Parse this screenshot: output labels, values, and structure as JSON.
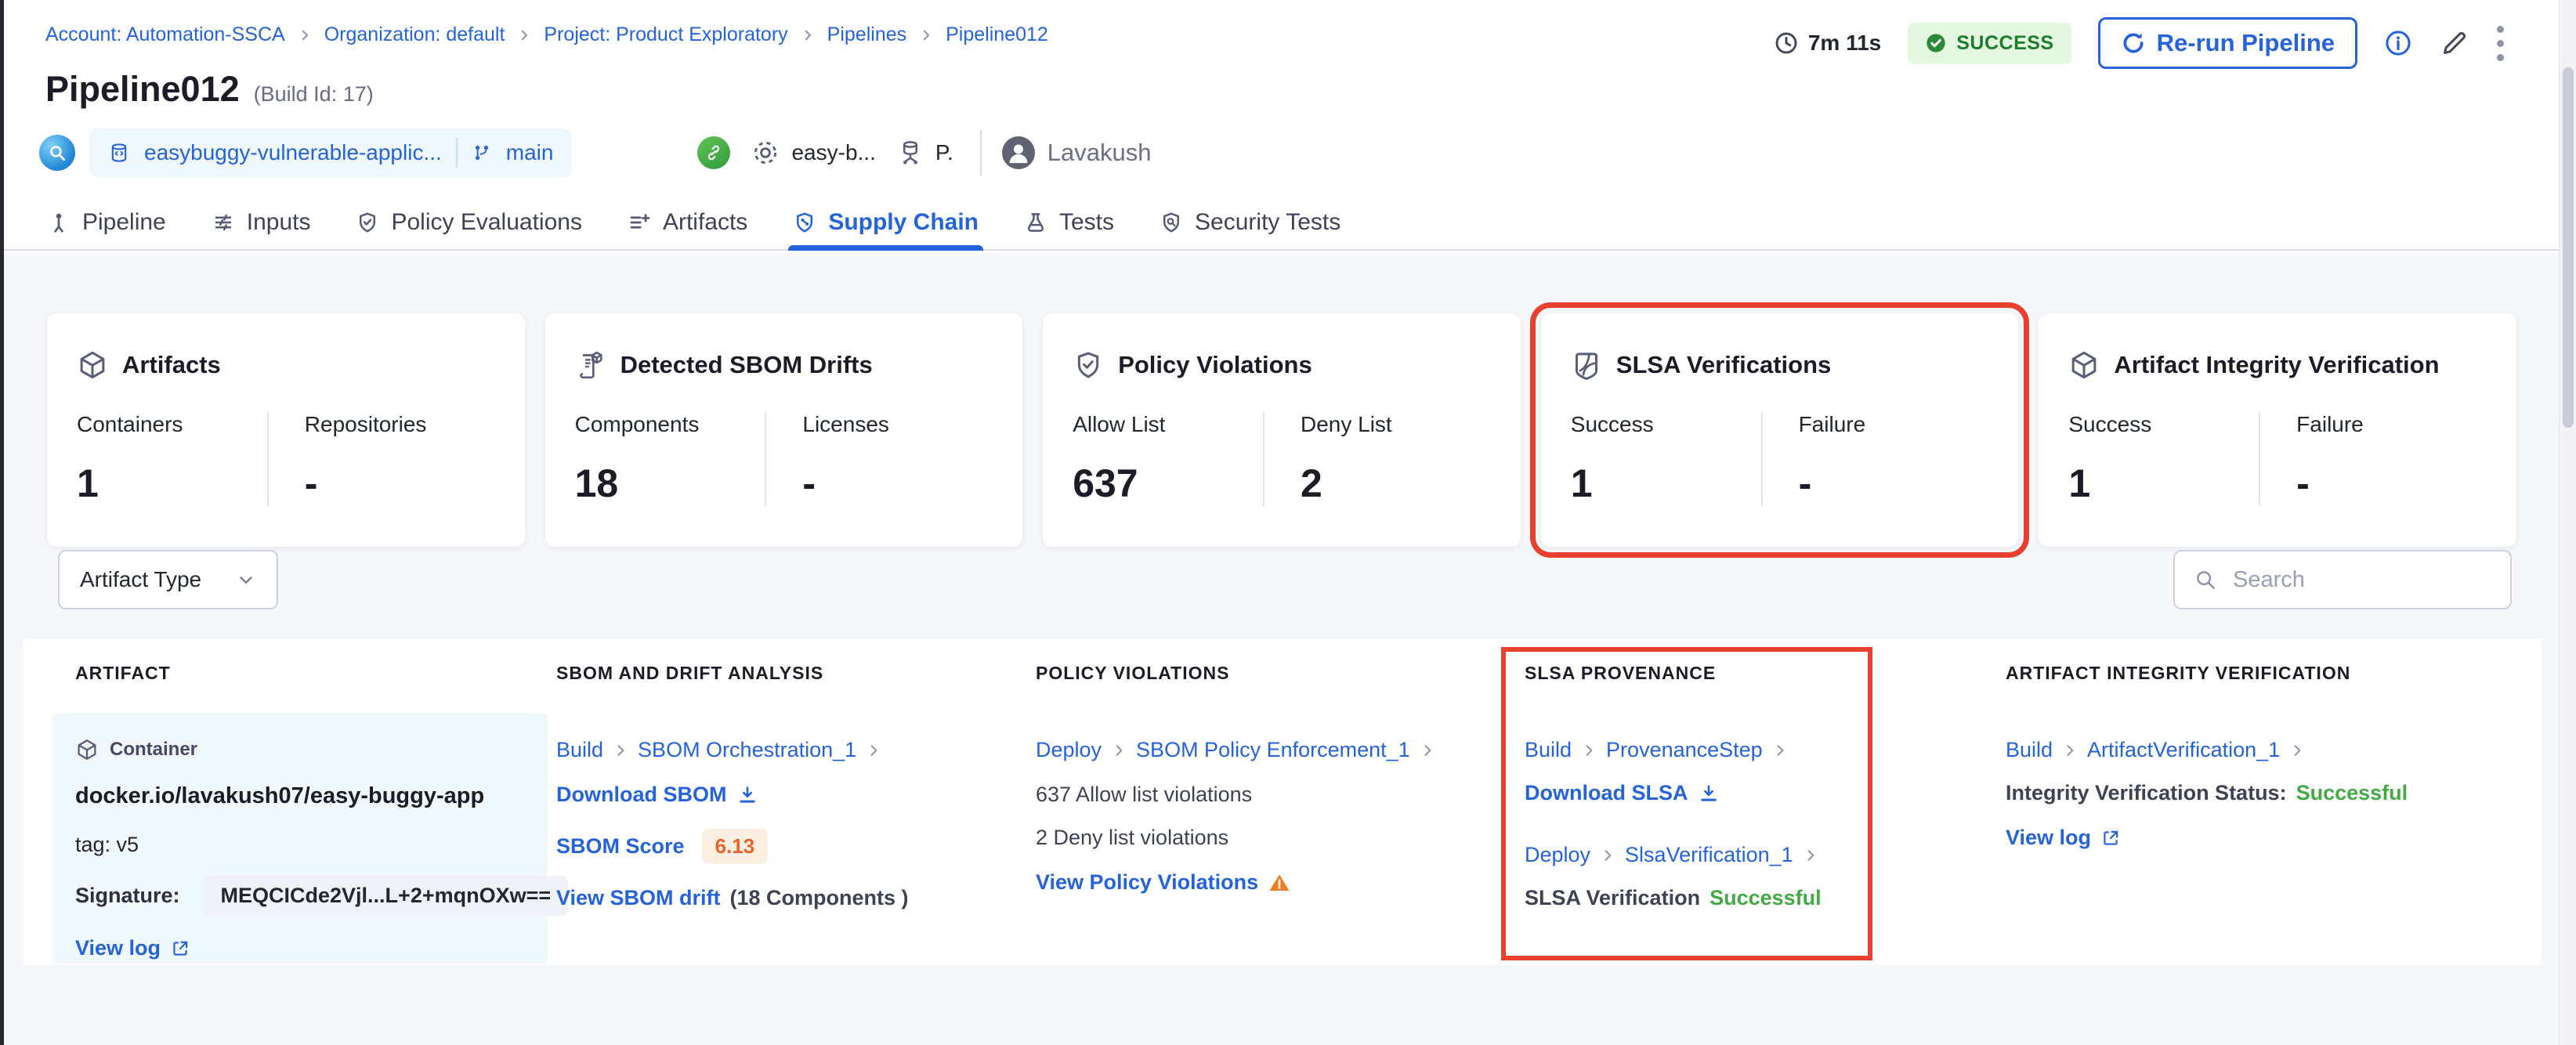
{
  "breadcrumb": {
    "items": [
      {
        "label": "Account: Automation-SSCA"
      },
      {
        "label": "Organization: default"
      },
      {
        "label": "Project: Product Exploratory"
      },
      {
        "label": "Pipelines"
      },
      {
        "label": "Pipeline012"
      }
    ]
  },
  "header": {
    "duration": "7m 11s",
    "status": "SUCCESS",
    "rerun_label": "Re-run Pipeline"
  },
  "title": {
    "name": "Pipeline012",
    "build_id": "(Build Id: 17)"
  },
  "meta": {
    "repo": "easybuggy-vulnerable-applic...",
    "branch": "main",
    "service": "easy-b...",
    "environment": "P.",
    "user": "Lavakush"
  },
  "tabs": [
    {
      "label": "Pipeline"
    },
    {
      "label": "Inputs"
    },
    {
      "label": "Policy Evaluations"
    },
    {
      "label": "Artifacts"
    },
    {
      "label": "Supply Chain"
    },
    {
      "label": "Tests"
    },
    {
      "label": "Security Tests"
    }
  ],
  "cards": [
    {
      "title": "Artifacts",
      "metrics": [
        {
          "label": "Containers",
          "value": "1"
        },
        {
          "label": "Repositories",
          "value": "-"
        }
      ]
    },
    {
      "title": "Detected SBOM Drifts",
      "metrics": [
        {
          "label": "Components",
          "value": "18"
        },
        {
          "label": "Licenses",
          "value": "-"
        }
      ]
    },
    {
      "title": "Policy Violations",
      "metrics": [
        {
          "label": "Allow List",
          "value": "637"
        },
        {
          "label": "Deny List",
          "value": "2"
        }
      ]
    },
    {
      "title": "SLSA Verifications",
      "metrics": [
        {
          "label": "Success",
          "value": "1"
        },
        {
          "label": "Failure",
          "value": "-"
        }
      ],
      "highlighted": true
    },
    {
      "title": "Artifact Integrity Verification",
      "metrics": [
        {
          "label": "Success",
          "value": "1"
        },
        {
          "label": "Failure",
          "value": "-"
        }
      ]
    }
  ],
  "filters": {
    "artifact_type_label": "Artifact Type",
    "search_placeholder": "Search"
  },
  "table": {
    "headers": [
      "ARTIFACT",
      "SBOM AND DRIFT ANALYSIS",
      "POLICY VIOLATIONS",
      "SLSA PROVENANCE",
      "ARTIFACT INTEGRITY VERIFICATION"
    ],
    "row": {
      "artifact": {
        "type": "Container",
        "image": "docker.io/lavakush07/easy-buggy-app",
        "tag": "tag: v5",
        "signature_label": "Signature:",
        "signature": "MEQCICde2Vjl...L+2+mqnOXw==",
        "view_log": "View log"
      },
      "sbom": {
        "stage": "Build",
        "step": "SBOM Orchestration_1",
        "download": "Download SBOM",
        "score_label": "SBOM Score",
        "score": "6.13",
        "drift_link": "View SBOM drift",
        "drift_count": "(18 Components )"
      },
      "policy": {
        "stage": "Deploy",
        "step": "SBOM Policy Enforcement_1",
        "allow": "637 Allow list violations",
        "deny": "2 Deny list violations",
        "view": "View Policy Violations"
      },
      "slsa": {
        "stage1": "Build",
        "step1": "ProvenanceStep",
        "download": "Download SLSA",
        "stage2": "Deploy",
        "step2": "SlsaVerification_1",
        "status_label": "SLSA Verification",
        "status": "Successful"
      },
      "integrity": {
        "stage": "Build",
        "step": "ArtifactVerification_1",
        "status_label": "Integrity Verification Status:",
        "status": "Successful",
        "view_log": "View log"
      }
    }
  },
  "colors": {
    "primary_blue": "#2563db",
    "highlight_red": "#e8402f",
    "success_green_badge": "#1e7d2c",
    "success_green_text": "#42ab45",
    "score_orange": "#e8642c",
    "warning_orange": "#f07e22",
    "artifact_cell_blue": "#eff9fd",
    "page_gray": "#f5f7fa"
  }
}
